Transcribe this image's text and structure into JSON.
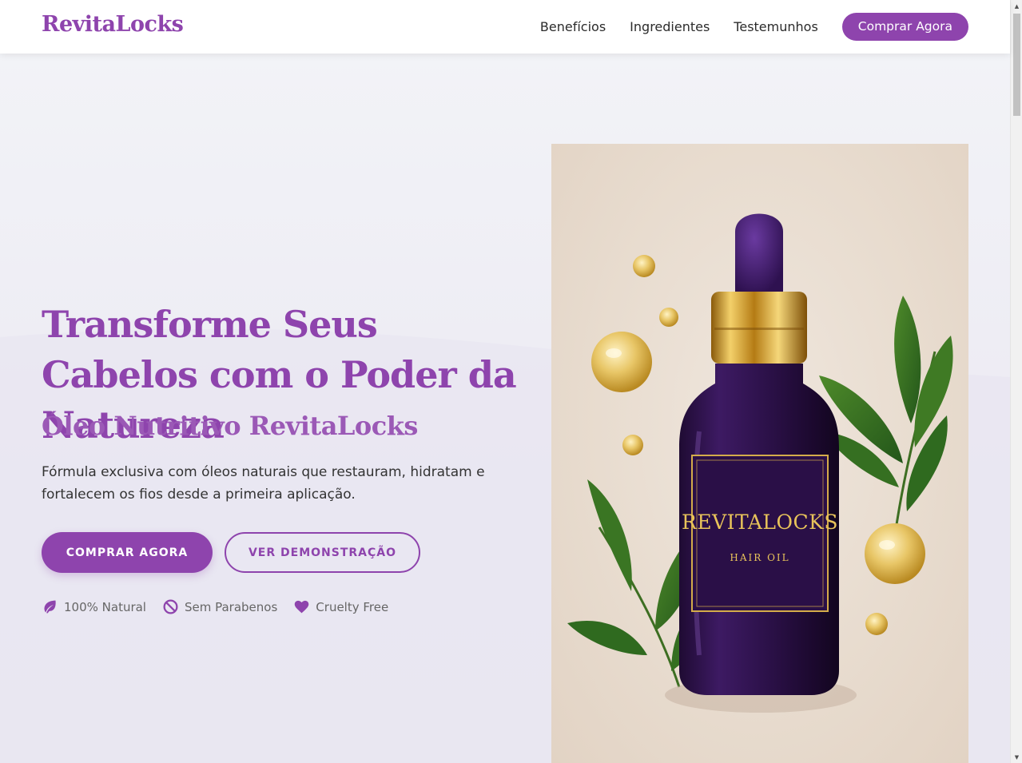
{
  "brand": "RevitaLocks",
  "nav": {
    "links": [
      "Benefícios",
      "Ingredientes",
      "Testemunhos"
    ],
    "cta": "Comprar Agora"
  },
  "hero": {
    "title": "Transforme Seus Cabelos com o Poder da Natureza",
    "subtitle": "Óleo Nutritivo RevitaLocks",
    "description": "Fórmula exclusiva com óleos naturais que restauram, hidratam e fortalecem os fios desde a primeira aplicação.",
    "primary_button": "COMPRAR AGORA",
    "secondary_button": "VER DEMONSTRAÇÃO",
    "badges": [
      {
        "icon": "leaf-icon",
        "label": "100% Natural"
      },
      {
        "icon": "ban-icon",
        "label": "Sem Parabenos"
      },
      {
        "icon": "heart-icon",
        "label": "Cruelty Free"
      }
    ]
  },
  "product_image": {
    "label_title": "REVITALOCKS",
    "label_subtitle": "HAIR OIL"
  },
  "colors": {
    "accent": "#8e44ad",
    "accent_light": "#9b59b6",
    "text": "#333333",
    "muted": "#666666"
  }
}
